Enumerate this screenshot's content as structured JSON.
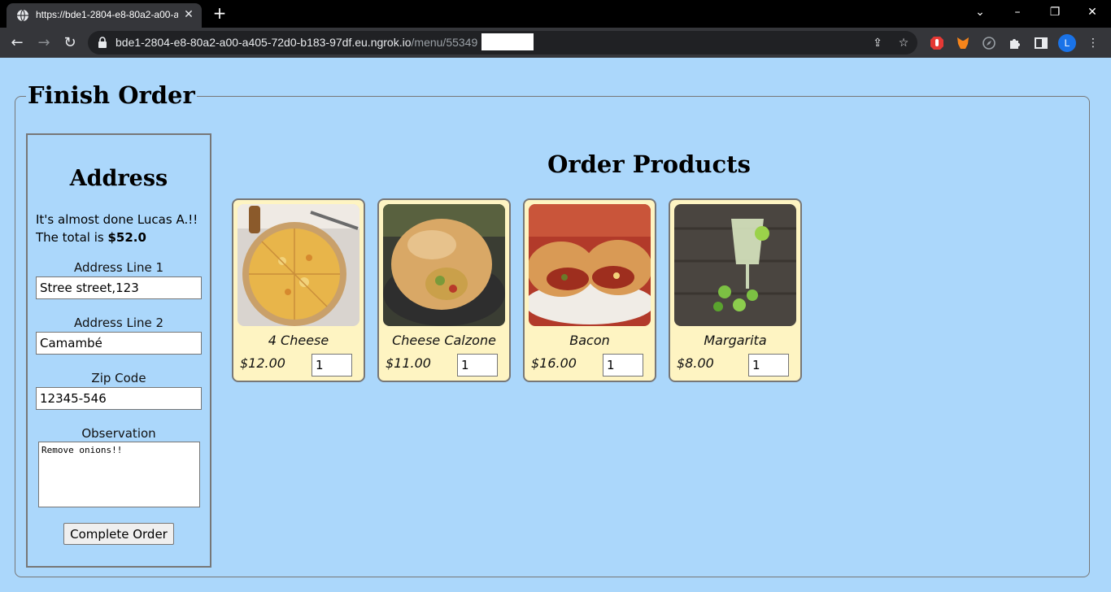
{
  "browser": {
    "tab_title": "https://bde1-2804-e8-80a2-a00-a",
    "url_host": "bde1-2804-e8-80a2-a00-a405-72d0-b183-97df.eu.ngrok.io",
    "url_path": "/menu/55349"
  },
  "page": {
    "legend": "Finish Order",
    "address": {
      "title": "Address",
      "greeting_line1": "It's almost done Lucas A.!!",
      "total_prefix": "The total is ",
      "total_value": "$52.0",
      "line1_label": "Address Line 1",
      "line1_value": "Stree street,123",
      "line2_label": "Address Line 2",
      "line2_value": "Camambé",
      "zip_label": "Zip Code",
      "zip_value": "12345-546",
      "observation_label": "Observation",
      "observation_value": "Remove onions!!",
      "complete_button": "Complete Order"
    },
    "products_title": "Order Products",
    "products": [
      {
        "name": "4 Cheese",
        "price": "$12.00",
        "qty": "1"
      },
      {
        "name": "Cheese Calzone",
        "price": "$11.00",
        "qty": "1"
      },
      {
        "name": "Bacon",
        "price": "$16.00",
        "qty": "1"
      },
      {
        "name": "Margarita",
        "price": "$8.00",
        "qty": "1"
      }
    ]
  },
  "profile_initial": "L"
}
